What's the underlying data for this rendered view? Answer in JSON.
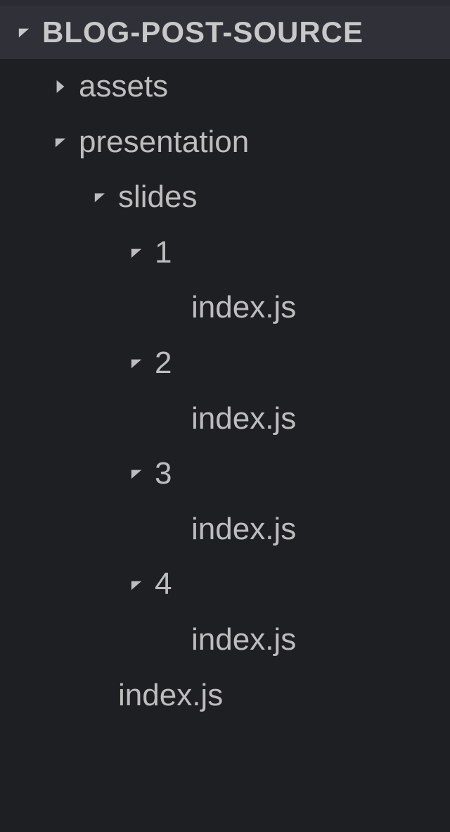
{
  "explorer": {
    "root": {
      "label": "BLOG-POST-SOURCE",
      "expanded": true
    },
    "nodes": [
      {
        "label": "assets",
        "indent": 1,
        "expanded": false,
        "type": "folder"
      },
      {
        "label": "presentation",
        "indent": 1,
        "expanded": true,
        "type": "folder"
      },
      {
        "label": "slides",
        "indent": 2,
        "expanded": true,
        "type": "folder"
      },
      {
        "label": "1",
        "indent": 3,
        "expanded": true,
        "type": "folder"
      },
      {
        "label": "index.js",
        "indent": 4,
        "expanded": null,
        "type": "file"
      },
      {
        "label": "2",
        "indent": 3,
        "expanded": true,
        "type": "folder"
      },
      {
        "label": "index.js",
        "indent": 4,
        "expanded": null,
        "type": "file"
      },
      {
        "label": "3",
        "indent": 3,
        "expanded": true,
        "type": "folder"
      },
      {
        "label": "index.js",
        "indent": 4,
        "expanded": null,
        "type": "file"
      },
      {
        "label": "4",
        "indent": 3,
        "expanded": true,
        "type": "folder"
      },
      {
        "label": "index.js",
        "indent": 4,
        "expanded": null,
        "type": "file"
      },
      {
        "label": "index.js",
        "indent": 2,
        "expanded": null,
        "type": "file"
      }
    ]
  }
}
